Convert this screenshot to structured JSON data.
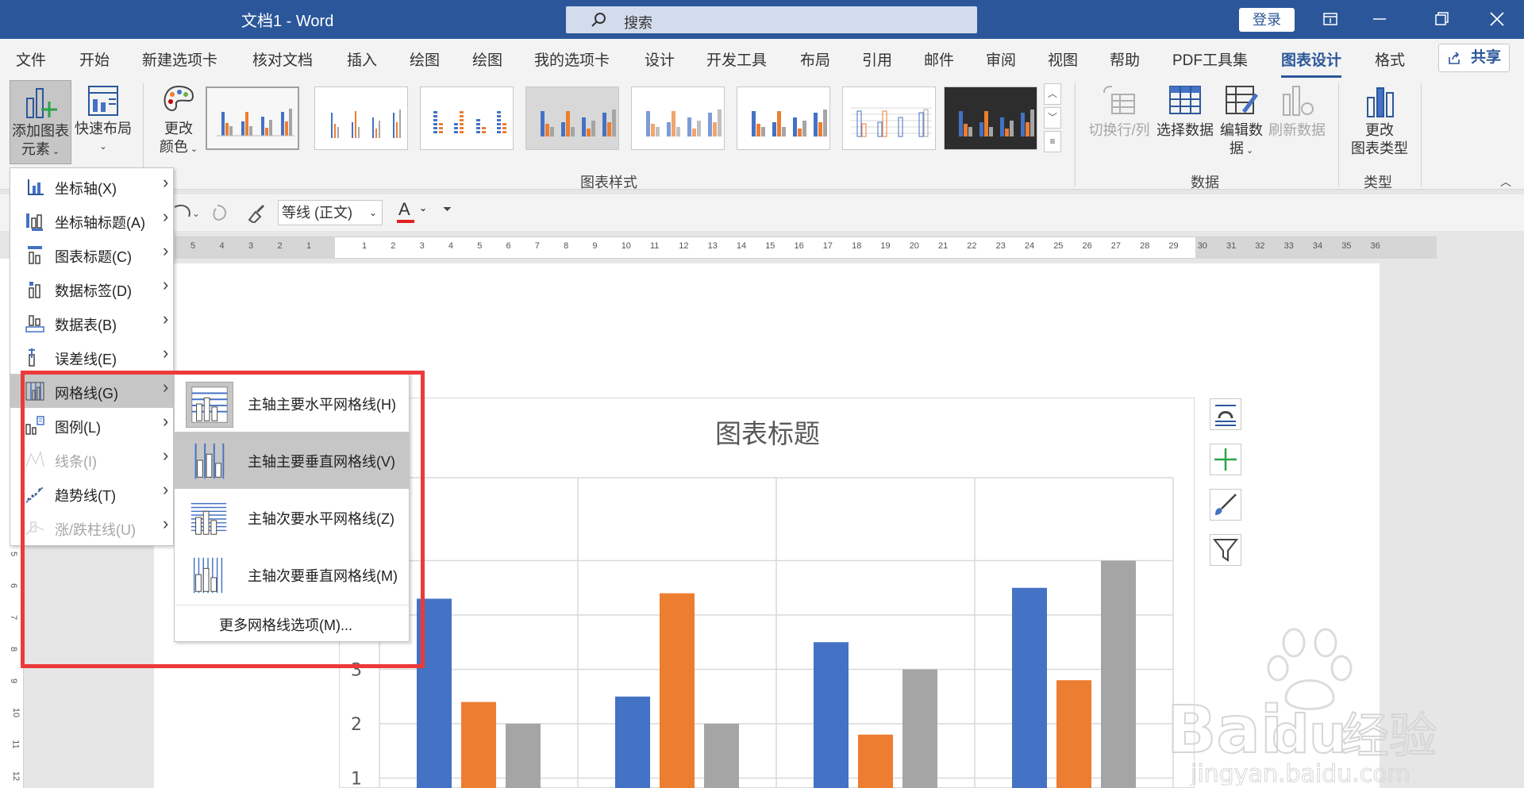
{
  "titlebar": {
    "doc_title": "文档1 - Word",
    "search_placeholder": "搜索",
    "login_label": "登录"
  },
  "tabs": [
    {
      "label": "文件"
    },
    {
      "label": "开始"
    },
    {
      "label": "新建选项卡"
    },
    {
      "label": "核对文档"
    },
    {
      "label": "插入"
    },
    {
      "label": "绘图"
    },
    {
      "label": "绘图"
    },
    {
      "label": "我的选项卡"
    },
    {
      "label": "设计"
    },
    {
      "label": "开发工具"
    },
    {
      "label": "布局"
    },
    {
      "label": "引用"
    },
    {
      "label": "邮件"
    },
    {
      "label": "审阅"
    },
    {
      "label": "视图"
    },
    {
      "label": "帮助"
    },
    {
      "label": "PDF工具集"
    },
    {
      "label": "图表设计",
      "active": true
    },
    {
      "label": "格式"
    }
  ],
  "share_label": "共享",
  "ribbon": {
    "add_element_line1": "添加图表",
    "add_element_line2": "元素",
    "quick_layout": "快速布局",
    "change_color_line1": "更改",
    "change_color_line2": "颜色",
    "chart_styles_label": "图表样式",
    "switch_row_col": "切换行/列",
    "select_data": "选择数据",
    "edit_data_line1": "编辑数",
    "edit_data_line2": "据",
    "refresh_data": "刷新数据",
    "data_group_label": "数据",
    "change_type_line1": "更改",
    "change_type_line2": "图表类型",
    "type_group_label": "类型"
  },
  "qat": {
    "font_name": "等线 (正文)",
    "font_color_glyph": "A"
  },
  "ruler_ticks": [
    "5",
    "4",
    "3",
    "2",
    "1",
    "1",
    "2",
    "3",
    "4",
    "5",
    "6",
    "7",
    "8",
    "9",
    "10",
    "11",
    "12",
    "13",
    "14",
    "15",
    "16",
    "17",
    "18",
    "19",
    "20",
    "21",
    "22",
    "23",
    "24",
    "25",
    "26",
    "27",
    "28",
    "29",
    "30",
    "31",
    "32",
    "33",
    "34",
    "35",
    "36"
  ],
  "vruler_ticks": [
    "5",
    "6",
    "7",
    "8",
    "9",
    "10",
    "11",
    "12"
  ],
  "menu1": {
    "items": [
      {
        "label": "坐标轴(X)",
        "icon": "axis-icon"
      },
      {
        "label": "坐标轴标题(A)",
        "icon": "axis-title-icon"
      },
      {
        "label": "图表标题(C)",
        "icon": "chart-title-icon"
      },
      {
        "label": "数据标签(D)",
        "icon": "data-labels-icon"
      },
      {
        "label": "数据表(B)",
        "icon": "data-table-icon"
      },
      {
        "label": "误差线(E)",
        "icon": "error-bars-icon"
      },
      {
        "label": "网格线(G)",
        "icon": "gridlines-icon",
        "hover": true
      },
      {
        "label": "图例(L)",
        "icon": "legend-icon"
      },
      {
        "label": "线条(I)",
        "icon": "lines-icon",
        "disabled": true
      },
      {
        "label": "趋势线(T)",
        "icon": "trendline-icon"
      },
      {
        "label": "涨/跌柱线(U)",
        "icon": "up-down-bars-icon",
        "disabled": true
      }
    ]
  },
  "menu2": {
    "items": [
      {
        "label": "主轴主要水平网格线(H)"
      },
      {
        "label": "主轴主要垂直网格线(V)",
        "hover": true
      },
      {
        "label": "主轴次要水平网格线(Z)"
      },
      {
        "label": "主轴次要垂直网格线(M)"
      }
    ],
    "more_label": "更多网格线选项(M)..."
  },
  "chart_data": {
    "type": "bar",
    "title": "图表标题",
    "categories": [
      "",
      "",
      "",
      ""
    ],
    "series": [
      {
        "color": "#4472c4",
        "values": [
          4.3,
          2.5,
          3.5,
          4.5
        ]
      },
      {
        "color": "#ed7d31",
        "values": [
          2.4,
          4.4,
          1.8,
          2.8
        ]
      },
      {
        "color": "#a5a5a5",
        "values": [
          2.0,
          2.0,
          3.0,
          5.0
        ]
      }
    ],
    "y_ticks": [
      "1",
      "2",
      "3"
    ],
    "ylim": [
      0,
      5
    ],
    "grid": true
  },
  "watermark": {
    "text1": "Bai",
    "text2": "du",
    "text3": "经验",
    "url": "jingyan.baidu.com"
  },
  "colors": {
    "word_blue": "#2b579a",
    "highlight_red": "#ec3a3a",
    "series1": "#4472c4",
    "series2": "#ed7d31",
    "series3": "#a5a5a5"
  }
}
